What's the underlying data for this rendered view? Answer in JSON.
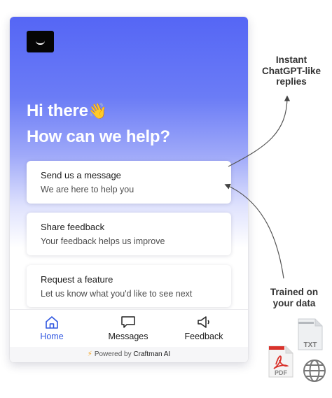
{
  "widget": {
    "greeting_line1": "Hi there",
    "greeting_emoji": "👋",
    "greeting_line2": "How can we help?",
    "cards": [
      {
        "title": "Send us a message",
        "subtitle": "We are here to help you"
      },
      {
        "title": "Share feedback",
        "subtitle": "Your feedback helps us improve"
      },
      {
        "title": "Request a feature",
        "subtitle": "Let us know what you'd like to see next"
      }
    ],
    "nav": {
      "home": "Home",
      "messages": "Messages",
      "feedback": "Feedback",
      "active": "home"
    },
    "powered_prefix": "Powered by",
    "powered_brand": "Craftman AI"
  },
  "annotations": {
    "top": [
      "Instant",
      "ChatGPT-like",
      "replies"
    ],
    "bottom": [
      "Trained on",
      "your data"
    ]
  },
  "file_icons": {
    "txt_label": "TXT",
    "pdf_label": "PDF"
  },
  "colors": {
    "accent": "#2f56e0",
    "hero_top": "#5566f5",
    "pdf_red": "#d9322b"
  }
}
